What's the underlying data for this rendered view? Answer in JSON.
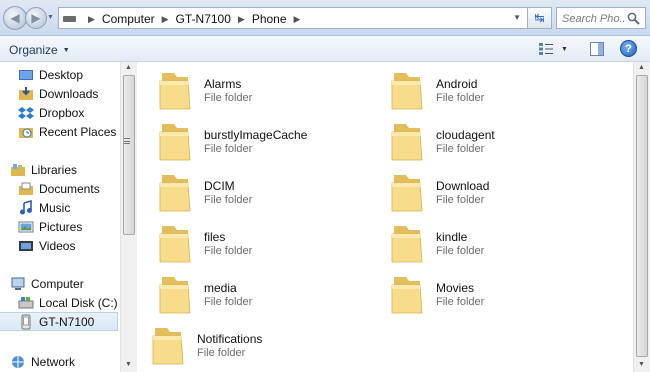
{
  "address": {
    "crumbs": [
      "Computer",
      "GT-N7100",
      "Phone"
    ],
    "search_placeholder": "Search Pho..."
  },
  "toolbar": {
    "organize_label": "Organize"
  },
  "navigation": {
    "favorites": [
      {
        "label": "Desktop",
        "icon": "desktop-icon"
      },
      {
        "label": "Downloads",
        "icon": "downloads-icon"
      },
      {
        "label": "Dropbox",
        "icon": "dropbox-icon"
      },
      {
        "label": "Recent Places",
        "icon": "recent-places-icon"
      }
    ],
    "libraries": {
      "label": "Libraries",
      "items": [
        {
          "label": "Documents",
          "icon": "documents-icon"
        },
        {
          "label": "Music",
          "icon": "music-icon"
        },
        {
          "label": "Pictures",
          "icon": "pictures-icon"
        },
        {
          "label": "Videos",
          "icon": "videos-icon"
        }
      ]
    },
    "computer": {
      "label": "Computer",
      "items": [
        {
          "label": "Local Disk (C:)",
          "icon": "local-disk-icon"
        },
        {
          "label": "GT-N7100",
          "icon": "phone-device-icon",
          "selected": true
        }
      ]
    },
    "network": {
      "label": "Network",
      "icon": "network-icon"
    }
  },
  "folders": [
    {
      "name": "Alarms",
      "type": "File folder"
    },
    {
      "name": "Android",
      "type": "File folder"
    },
    {
      "name": "burstlyImageCache",
      "type": "File folder"
    },
    {
      "name": "cloudagent",
      "type": "File folder"
    },
    {
      "name": "DCIM",
      "type": "File folder"
    },
    {
      "name": "Download",
      "type": "File folder"
    },
    {
      "name": "files",
      "type": "File folder"
    },
    {
      "name": "kindle",
      "type": "File folder"
    },
    {
      "name": "media",
      "type": "File folder"
    },
    {
      "name": "Movies",
      "type": "File folder"
    },
    {
      "name": "Notifications",
      "type": "File folder"
    }
  ],
  "colors": {
    "folder_front": "#f7dc8c",
    "folder_back": "#e4be5c",
    "selection": "#d9e7f7"
  }
}
